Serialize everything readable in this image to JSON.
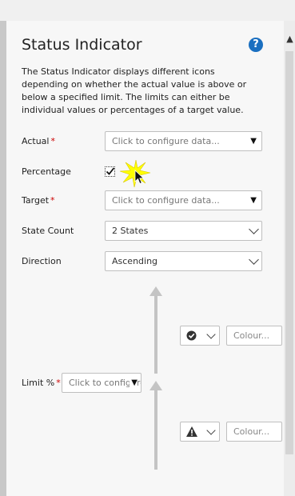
{
  "panel": {
    "title": "Status Indicator",
    "help_icon": "?",
    "description": "The Status Indicator displays different icons depending on whether the actual value is above or below a specified limit. The limits can either be individual values or percentages of a target value."
  },
  "fields": {
    "actual": {
      "label": "Actual",
      "required": "*",
      "placeholder": "Click to configure data..."
    },
    "percentage": {
      "label": "Percentage",
      "checked": true
    },
    "target": {
      "label": "Target",
      "required": "*",
      "placeholder": "Click to configure data..."
    },
    "state_count": {
      "label": "State Count",
      "value": "2 States"
    },
    "direction": {
      "label": "Direction",
      "value": "Ascending"
    }
  },
  "states": [
    {
      "icon": "check-circle-icon",
      "colour_placeholder": "Colour..."
    },
    {
      "icon": "warning-triangle-icon",
      "colour_placeholder": "Colour..."
    }
  ],
  "limit": {
    "label": "Limit %",
    "required": "*",
    "placeholder": "Click to configure data..."
  },
  "dropdown_arrow": "▼"
}
